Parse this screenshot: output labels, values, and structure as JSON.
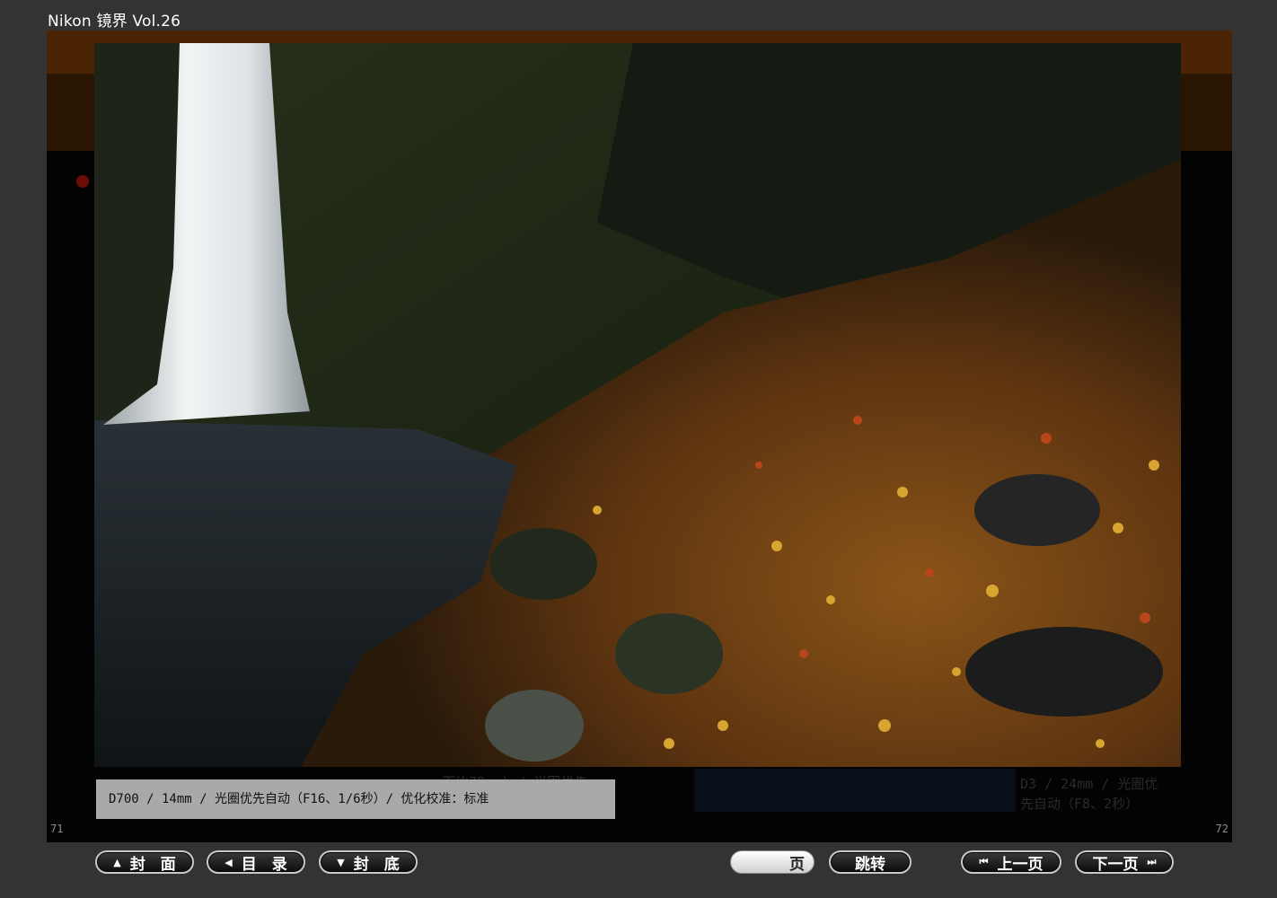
{
  "window": {
    "title": "Nikon 镜界 Vol.26"
  },
  "magazine": {
    "left_page_number": "71",
    "right_page_number": "72",
    "caption": "D700 / 14mm / 光圈优先自动（F16、1/6秒）/ 优化校准：标准",
    "bg_caption_center": "下约78mm) / 光圈优先",
    "bg_caption_right_line1": "D3 / 24mm / 光圈优",
    "bg_caption_right_line2": "先自动（F8、2秒）",
    "photo_subject": "waterfall with autumn leaves"
  },
  "controls": {
    "cover_label": "封　面",
    "toc_label": "目　录",
    "back_cover_label": "封　底",
    "page_suffix": "页",
    "jump_label": "跳转",
    "prev_label": "上一页",
    "next_label": "下一页"
  },
  "colors": {
    "background": "#333333",
    "stage": "#030303",
    "accent_band": "#4a2404",
    "caption_bg": "#a9a9a9"
  }
}
